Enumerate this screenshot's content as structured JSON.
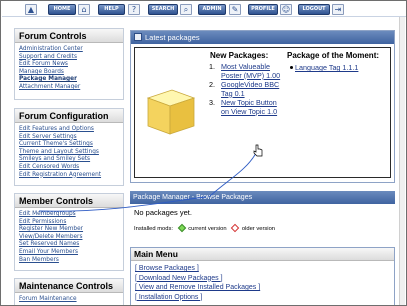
{
  "nav": {
    "buttons": [
      "HOME",
      "HELP",
      "SEARCH",
      "ADMIN",
      "PROFILE",
      "LOGOUT"
    ]
  },
  "forum_controls": {
    "title": "Forum Controls",
    "items": [
      "Administration Center",
      "Support and Credits",
      "Edit Forum News",
      "Manage Boards",
      "Package Manager",
      "Attachment Manager"
    ]
  },
  "forum_configuration": {
    "title": "Forum Configuration",
    "items": [
      "Edit Features and Options",
      "Edit Server Settings",
      "Current Theme's Settings",
      "Theme and Layout Settings",
      "Smileys and Smiley Sets",
      "Edit Censored Words",
      "Edit Registration Agreement"
    ]
  },
  "member_controls": {
    "title": "Member Controls",
    "items": [
      "Edit Membergroups",
      "Edit Permissions",
      "Register New Member",
      "View/Delete Members",
      "Set Reserved Names",
      "Email Your Members",
      "Ban Members"
    ]
  },
  "maintenance_controls": {
    "title": "Maintenance Controls",
    "items": [
      "Forum Maintenance"
    ]
  },
  "latest_packages": {
    "title": "Latest packages",
    "new_packages_title": "New Packages:",
    "new_packages": [
      {
        "num": "1.",
        "label": "Most Valueable Poster (MVP) 1.00"
      },
      {
        "num": "2.",
        "label": "GoogleVideo BBC Tag 0.1"
      },
      {
        "num": "3.",
        "label": "New Topic Button on View Topic 1.0"
      }
    ],
    "moment_title": "Package of the Moment:",
    "moment_item": "Language Tag 1.1.1"
  },
  "package_tabs": {
    "tab1": "Package Manager",
    "separator": " - ",
    "tab2": "Browse Packages"
  },
  "status": {
    "no_packages": "No packages yet.",
    "installed_mods": "Installed mods:",
    "current_version": "current version",
    "older_version": "older version",
    "current_color": "#4caf50",
    "older_color": "#e53935"
  },
  "main_menu": {
    "title": "Main Menu",
    "items": [
      "[ Browse Packages ]",
      "[ Download New Packages ]",
      "[ View and Remove Installed Packages ]",
      "[ Installation Options ]"
    ]
  }
}
